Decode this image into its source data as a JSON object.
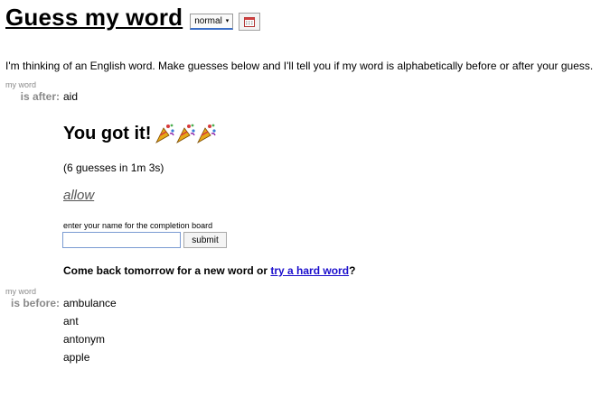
{
  "header": {
    "title": "Guess my word",
    "mode": "normal",
    "mode_arrow": "▾",
    "calendar_icon": "calendar-icon"
  },
  "intro": "I'm thinking of an English word. Make guesses below and I'll tell you if my word is alphabetically before or after your guess.",
  "after": {
    "my_word_label": "my word",
    "relation": "is after:",
    "words": [
      "aid"
    ]
  },
  "result": {
    "headline": "You got it!",
    "party_icon": "party-popper-icon",
    "stats": "(6 guesses in 1m 3s)",
    "word": "allow"
  },
  "completion": {
    "label": "enter your name for the completion board",
    "name_value": "",
    "submit": "submit"
  },
  "come_back": {
    "prefix": "Come back tomorrow for a new word or ",
    "link": "try a hard word",
    "suffix": "?"
  },
  "before": {
    "my_word_label": "my word",
    "relation": "is before:",
    "words": [
      "ambulance",
      "ant",
      "antonym",
      "apple"
    ]
  },
  "colors": {
    "link": "#1a0dcc",
    "muted_label": "#8a8a8a",
    "answer": "#555555"
  }
}
